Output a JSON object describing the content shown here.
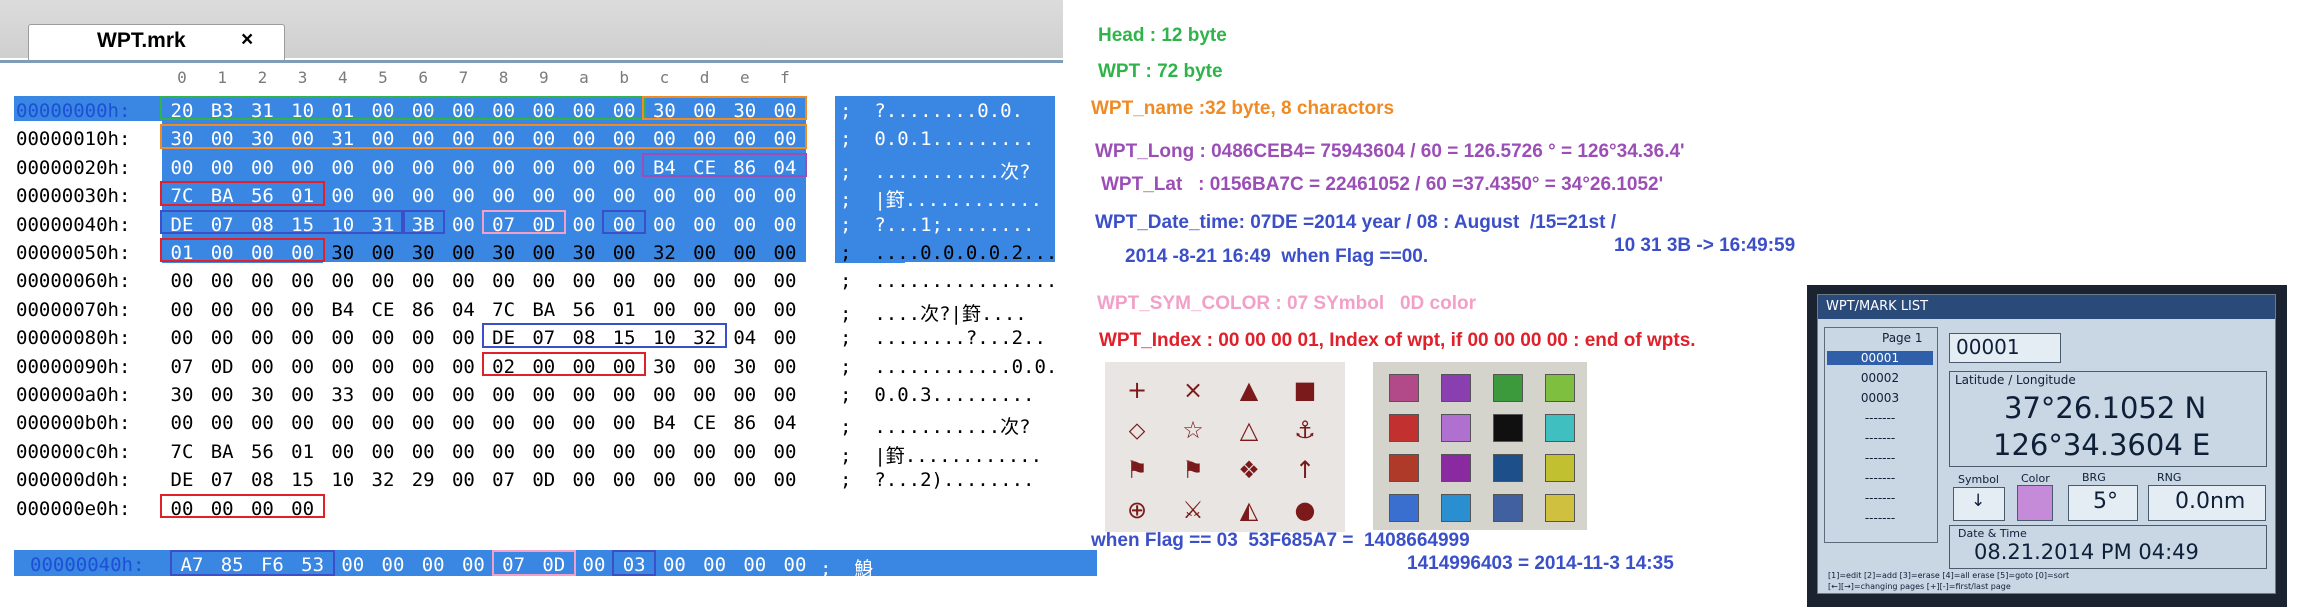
{
  "tab": {
    "title": "WPT.mrk",
    "close": "×"
  },
  "column_headers": [
    "0",
    "1",
    "2",
    "3",
    "4",
    "5",
    "6",
    "7",
    "8",
    "9",
    "a",
    "b",
    "c",
    "d",
    "e",
    "f"
  ],
  "rows": [
    {
      "addr": "00000000h:",
      "bytes": [
        "20",
        "B3",
        "31",
        "10",
        "01",
        "00",
        "00",
        "00",
        "00",
        "00",
        "00",
        "00",
        "30",
        "00",
        "30",
        "00"
      ],
      "ascii": ";  ?........0.0."
    },
    {
      "addr": "00000010h:",
      "bytes": [
        "30",
        "00",
        "30",
        "00",
        "31",
        "00",
        "00",
        "00",
        "00",
        "00",
        "00",
        "00",
        "00",
        "00",
        "00",
        "00"
      ],
      "ascii": ";  0.0.1........."
    },
    {
      "addr": "00000020h:",
      "bytes": [
        "00",
        "00",
        "00",
        "00",
        "00",
        "00",
        "00",
        "00",
        "00",
        "00",
        "00",
        "00",
        "B4",
        "CE",
        "86",
        "04"
      ],
      "ascii": ";  ...........次?"
    },
    {
      "addr": "00000030h:",
      "bytes": [
        "7C",
        "BA",
        "56",
        "01",
        "00",
        "00",
        "00",
        "00",
        "00",
        "00",
        "00",
        "00",
        "00",
        "00",
        "00",
        "00"
      ],
      "ascii": ";  |篈............"
    },
    {
      "addr": "00000040h:",
      "bytes": [
        "DE",
        "07",
        "08",
        "15",
        "10",
        "31",
        "3B",
        "00",
        "07",
        "0D",
        "00",
        "00",
        "00",
        "00",
        "00",
        "00"
      ],
      "ascii": ";  ?...1;........"
    },
    {
      "addr": "00000050h:",
      "bytes": [
        "01",
        "00",
        "00",
        "00",
        "30",
        "00",
        "30",
        "00",
        "30",
        "00",
        "30",
        "00",
        "32",
        "00",
        "00",
        "00"
      ],
      "ascii": ";  ....0.0.0.0.2..."
    },
    {
      "addr": "00000060h:",
      "bytes": [
        "00",
        "00",
        "00",
        "00",
        "00",
        "00",
        "00",
        "00",
        "00",
        "00",
        "00",
        "00",
        "00",
        "00",
        "00",
        "00"
      ],
      "ascii": ";  ................"
    },
    {
      "addr": "00000070h:",
      "bytes": [
        "00",
        "00",
        "00",
        "00",
        "B4",
        "CE",
        "86",
        "04",
        "7C",
        "BA",
        "56",
        "01",
        "00",
        "00",
        "00",
        "00"
      ],
      "ascii": ";  ....次?|篈...."
    },
    {
      "addr": "00000080h:",
      "bytes": [
        "00",
        "00",
        "00",
        "00",
        "00",
        "00",
        "00",
        "00",
        "DE",
        "07",
        "08",
        "15",
        "10",
        "32",
        "04",
        "00"
      ],
      "ascii": ";  ........?...2.."
    },
    {
      "addr": "00000090h:",
      "bytes": [
        "07",
        "0D",
        "00",
        "00",
        "00",
        "00",
        "00",
        "00",
        "02",
        "00",
        "00",
        "00",
        "30",
        "00",
        "30",
        "00"
      ],
      "ascii": ";  ............0.0."
    },
    {
      "addr": "000000a0h:",
      "bytes": [
        "30",
        "00",
        "30",
        "00",
        "33",
        "00",
        "00",
        "00",
        "00",
        "00",
        "00",
        "00",
        "00",
        "00",
        "00",
        "00"
      ],
      "ascii": ";  0.0.3........."
    },
    {
      "addr": "000000b0h:",
      "bytes": [
        "00",
        "00",
        "00",
        "00",
        "00",
        "00",
        "00",
        "00",
        "00",
        "00",
        "00",
        "00",
        "B4",
        "CE",
        "86",
        "04"
      ],
      "ascii": ";  ...........次?"
    },
    {
      "addr": "000000c0h:",
      "bytes": [
        "7C",
        "BA",
        "56",
        "01",
        "00",
        "00",
        "00",
        "00",
        "00",
        "00",
        "00",
        "00",
        "00",
        "00",
        "00",
        "00"
      ],
      "ascii": ";  |篈............"
    },
    {
      "addr": "000000d0h:",
      "bytes": [
        "DE",
        "07",
        "08",
        "15",
        "10",
        "32",
        "29",
        "00",
        "07",
        "0D",
        "00",
        "00",
        "00",
        "00",
        "00",
        "00"
      ],
      "ascii": ";  ?...2)........"
    },
    {
      "addr": "000000e0h:",
      "bytes": [
        "00",
        "00",
        "00",
        "00",
        "",
        "",
        "",
        "",
        "",
        "",
        "",
        "",
        "",
        "",
        "",
        ""
      ],
      "ascii": ""
    }
  ],
  "extra_row": {
    "addr": "00000040h:",
    "bytes": [
      "A7",
      "85",
      "F6",
      "53",
      "00",
      "00",
      "00",
      "00",
      "07",
      "0D",
      "00",
      "03",
      "00",
      "00",
      "00",
      "00"
    ],
    "ascii": ";  鯓"
  },
  "notes": {
    "head": "Head : 12 byte",
    "wpt": "WPT : 72 byte",
    "wpt_name": "WPT_name :32 byte, 8 charactors",
    "wpt_long": "WPT_Long : 0486CEB4= 75943604 / 60 = 126.5726 ° = 126°34.36.4'",
    "wpt_lat": "WPT_Lat   : 0156BA7C = 22461052 / 60 =37.4350° = 34°26.1052'",
    "wpt_date": "WPT_Date_time: 07DE =2014 year / 08 : August  /15=21st /",
    "wpt_date2": "10 31 3B -> 16:49:59",
    "wpt_date3": "2014 -8-21 16:49  when Flag ==00.",
    "sym_color": "WPT_SYM_COLOR : 07 SYmbol   0D color",
    "index": "WPT_Index : 00 00 00 01, Index of wpt, if 00 00 00 00 : end of wpts.",
    "flag03": "when Flag == 03  53F685A7 =  1408664999",
    "flag03b": "1414996403 = 2014-11-3 14:35"
  },
  "symbols": [
    "+",
    "×",
    "▲",
    "■",
    "⬦",
    "☆",
    "△",
    "⚓",
    "⚑",
    "⚑",
    "❖",
    "↑",
    "⊕",
    "⚔",
    "◭",
    "●"
  ],
  "colors": {
    "head": "#2fb34a",
    "wpt": "#2fb34a",
    "name": "#f08a24",
    "long": "#9b4fb6",
    "date": "#3b4fc9",
    "symcolor": "#f2a0c8",
    "index": "#e0202a",
    "flag": "#3b4fc9",
    "selection": "#3a86e3",
    "swatches": [
      "#b24a8a",
      "#8a3fb0",
      "#3c9a3c",
      "#7fbf3f",
      "#c23030",
      "#b070d0",
      "#101010",
      "#3fbfbf",
      "#b03a2a",
      "#8a2aa0",
      "#1d4f8a",
      "#c0c030",
      "#3a6fd0",
      "#2a8fd0",
      "#4060a0",
      "#d0c040"
    ]
  },
  "device": {
    "header": "WPT/MARK LIST",
    "page": "Page 1",
    "list": [
      "00001",
      "00002",
      "00003",
      "-------",
      "-------",
      "-------",
      "-------",
      "-------",
      "-------"
    ],
    "id_value": "00001",
    "latlon_label": "Latitude / Longitude",
    "lat": "37°26.1052 N",
    "lon": "126°34.3604 E",
    "symbol_label": "Symbol",
    "color_label": "Color",
    "brg_label": "BRG",
    "rng_label": "RNG",
    "symbol_value": "↓",
    "brg_value": "5°",
    "rng_value": "0.0nm",
    "date_label": "Date & Time",
    "date_value": "08.21.2014 PM 04:49",
    "footer1": "[1]=edit [2]=add [3]=erase [4]=all erase [5]=goto [0]=sort",
    "footer2": "[←][→]=changing pages [+][-]=first/last page"
  }
}
